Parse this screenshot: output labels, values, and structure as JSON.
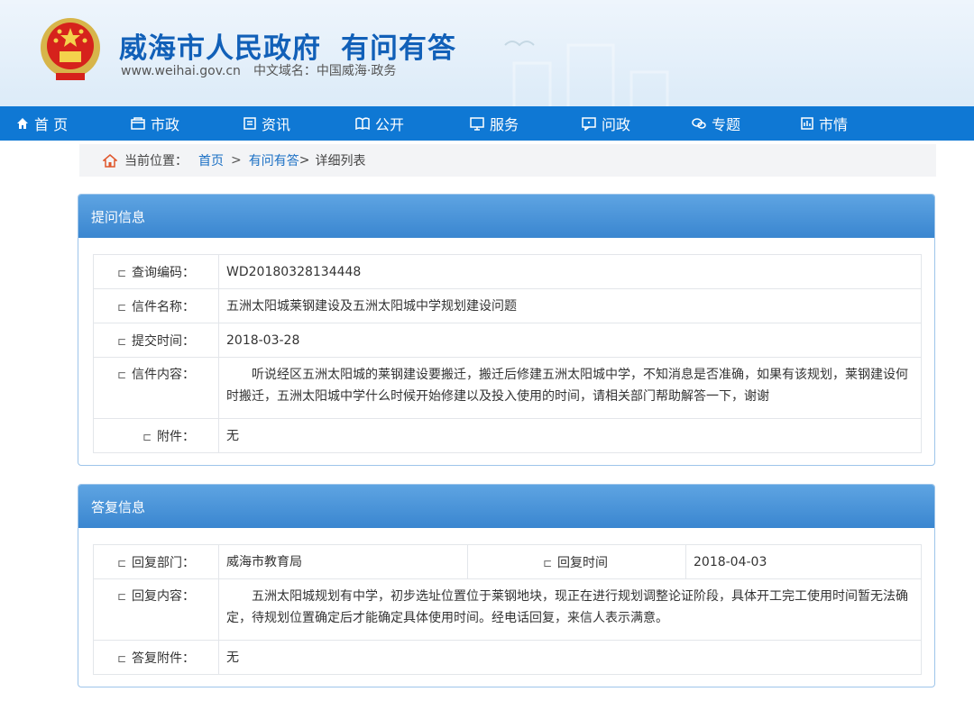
{
  "header": {
    "title": "威海市人民政府",
    "subtitle": "有问有答",
    "url": "www.weihai.gov.cn",
    "cn_domain": "中文域名：中国威海·政务"
  },
  "nav": {
    "items": [
      {
        "label": "首 页",
        "icon": "home-icon"
      },
      {
        "label": "市政",
        "icon": "building-icon"
      },
      {
        "label": "资讯",
        "icon": "news-icon"
      },
      {
        "label": "公开",
        "icon": "book-icon"
      },
      {
        "label": "服务",
        "icon": "monitor-icon"
      },
      {
        "label": "问政",
        "icon": "chat-monitor-icon"
      },
      {
        "label": "专题",
        "icon": "chat-bubbles-icon"
      },
      {
        "label": "市情",
        "icon": "chart-icon"
      }
    ]
  },
  "breadcrumb": {
    "prefix": "当前位置：",
    "home": "首页",
    "sep": ">",
    "section": "有问有答",
    "section_sep": ">",
    "current": "详细列表"
  },
  "question": {
    "heading": "提问信息",
    "marker": "⊏",
    "rows": [
      {
        "label": "查询编码：",
        "value": "WD20180328134448"
      },
      {
        "label": "信件名称：",
        "value": "五洲太阳城莱钢建设及五洲太阳城中学规划建设问题"
      },
      {
        "label": "提交时间：",
        "value": "2018-03-28"
      },
      {
        "label": "信件内容：",
        "value": "听说经区五洲太阳城的莱钢建设要搬迁，搬迁后修建五洲太阳城中学，不知消息是否准确，如果有该规划，莱钢建设何时搬迁，五洲太阳城中学什么时候开始修建以及投入使用的时间，请相关部门帮助解答一下，谢谢"
      },
      {
        "label": "附件：",
        "value": "无"
      }
    ]
  },
  "answer": {
    "heading": "答复信息",
    "dept_label": "回复部门：",
    "dept_value": "威海市教育局",
    "time_label": "回复时间",
    "time_value": "2018-04-03",
    "content_label": "回复内容：",
    "content_value": "五洲太阳城规划有中学，初步选址位置位于莱钢地块，现正在进行规划调整论证阶段，具体开工完工使用时间暂无法确定，待规划位置确定后才能确定具体使用时间。经电话回复，来信人表示满意。",
    "attach_label": "答复附件：",
    "attach_value": "无"
  },
  "colors": {
    "nav_bg": "#0f78d4",
    "panel_head": "#3a86d0",
    "title_blue": "#1160b8",
    "link_blue": "#1a6fc4"
  }
}
